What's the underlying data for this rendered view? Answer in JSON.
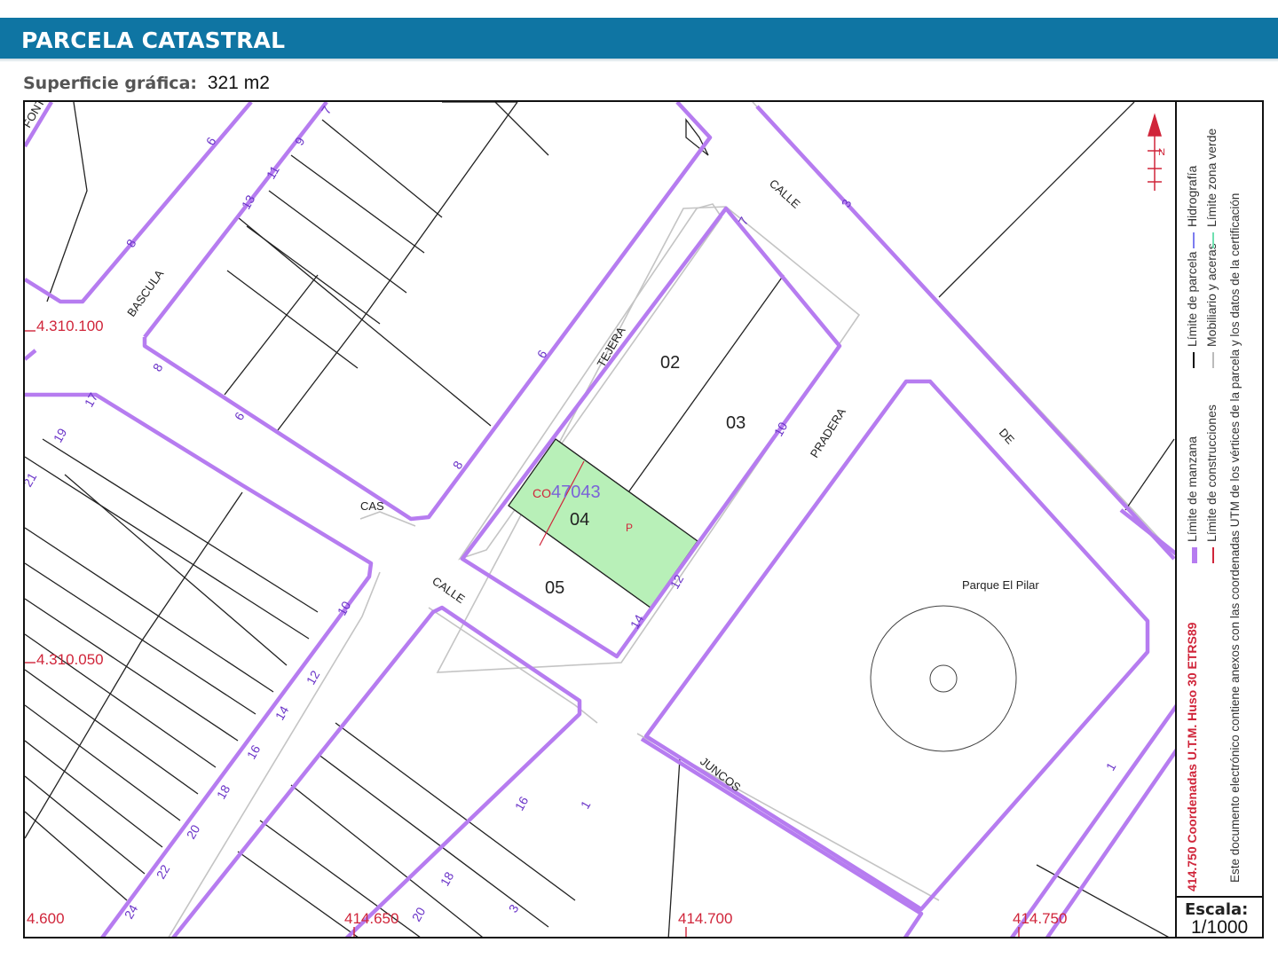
{
  "header": {
    "title": "PARCELA CATASTRAL"
  },
  "surface": {
    "label": "Superficie gráfica:",
    "value": "321 m2"
  },
  "map": {
    "parcel_ref": "47043",
    "parcel_mark": "P",
    "construction_mark": "CO",
    "subparcels": [
      "02",
      "03",
      "04",
      "05"
    ],
    "park_name": "Parque El Pilar",
    "streets": [
      "CALLE",
      "TEJERA",
      "BASCULA",
      "CAS",
      "CALLE",
      "PRADERA",
      "DE",
      "JUNCOS",
      "CALLE",
      "FONTA"
    ],
    "house_numbers": [
      "7",
      "9",
      "11",
      "13",
      "6",
      "8",
      "8",
      "6",
      "8",
      "6",
      "17",
      "19",
      "21",
      "10",
      "12",
      "14",
      "16",
      "18",
      "20",
      "22",
      "24",
      "7",
      "10",
      "12",
      "14",
      "3",
      "1",
      "16",
      "18",
      "20",
      "3",
      "1"
    ],
    "coords": {
      "y1": "4.310.100",
      "y2": "4.310.050",
      "x0": "4.600",
      "x1": "414.650",
      "x2": "414.700",
      "x3": "414.750"
    },
    "colors": {
      "block": "#b67cf0",
      "parcel_fill": "#b8f0b8",
      "accent": "#0f75a3",
      "coord": "#d0253a"
    }
  },
  "legend": {
    "items": [
      {
        "label": "Límite de manzana",
        "color": "#b67cf0"
      },
      {
        "label": "Límite de parcela",
        "color": "#111111"
      },
      {
        "label": "Hidrografía",
        "color": "#7c7cf0"
      },
      {
        "label": "Límite de construcciones",
        "color": "#d0253a"
      },
      {
        "label": "Mobiliario y aceras",
        "color": "#bbbbbb"
      },
      {
        "label": "Límite zona verde",
        "color": "#6fe0b0"
      }
    ],
    "coordinates_note": "414.750 Coordenadas U.T.M. Huso 30 ETRS89",
    "document_note": "Este documento electrónico contiene anexos con las coordenadas UTM de los vértices de la parcela y los datos de la certificación",
    "north_label": "N"
  },
  "scale": {
    "label": "Escala:",
    "value": "1/1000"
  }
}
